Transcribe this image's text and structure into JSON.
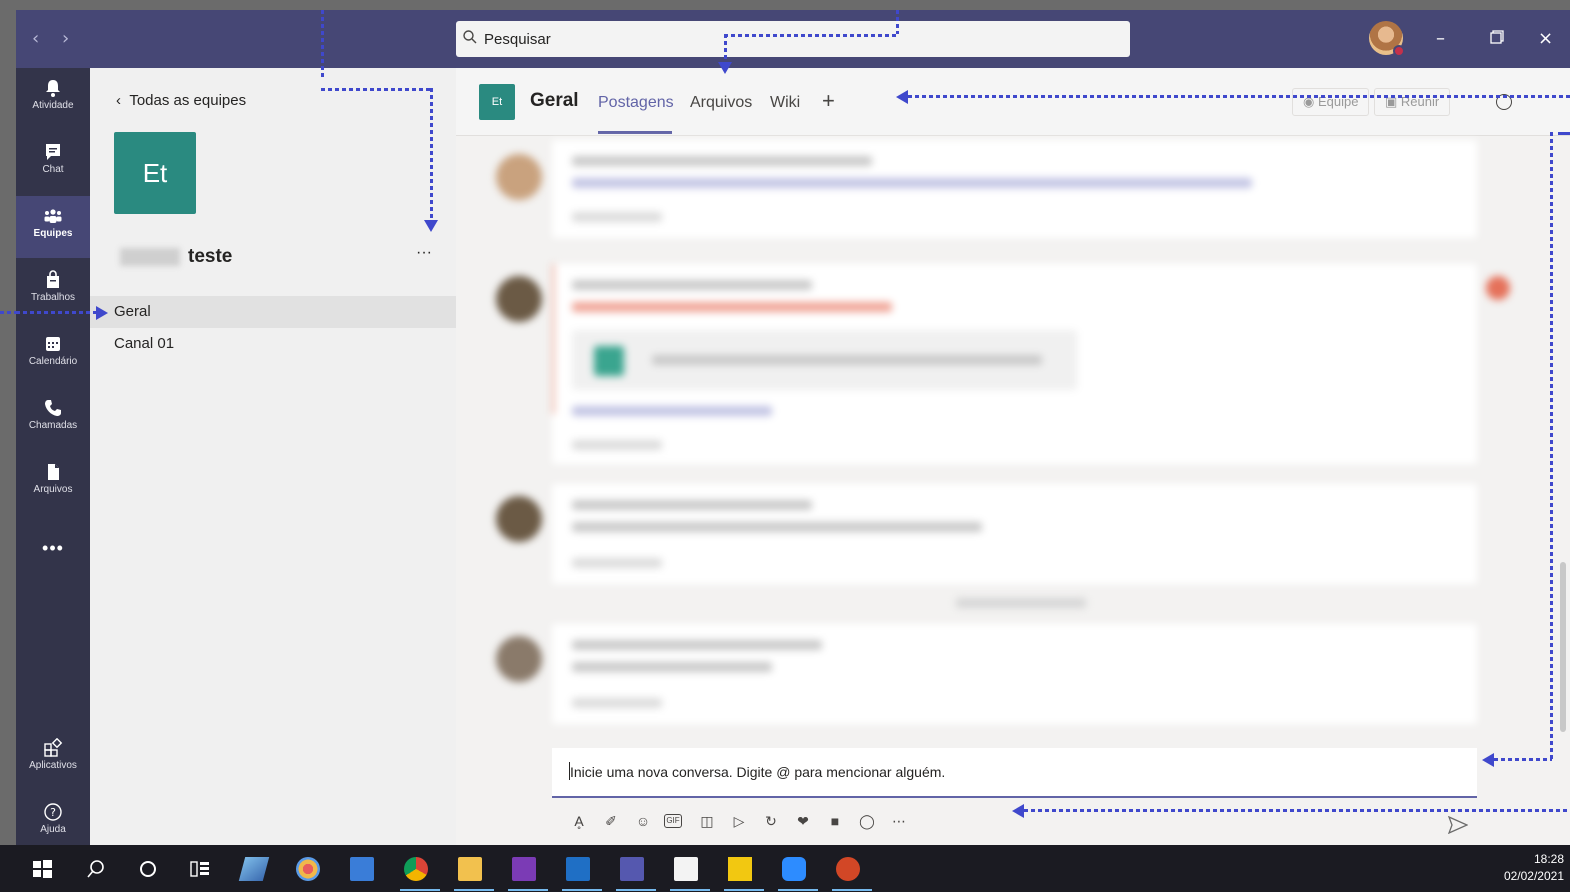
{
  "titlebar": {
    "search_placeholder": "Pesquisar",
    "back_icon": "chevron-left-icon",
    "forward_icon": "chevron-right-icon",
    "window_controls": [
      "minimize",
      "restore",
      "close"
    ]
  },
  "rail": {
    "items": [
      {
        "label": "Atividade",
        "icon": "bell-icon"
      },
      {
        "label": "Chat",
        "icon": "chat-icon"
      },
      {
        "label": "Equipes",
        "icon": "teams-icon",
        "active": true
      },
      {
        "label": "Trabalhos",
        "icon": "assignments-icon"
      },
      {
        "label": "Calendário",
        "icon": "calendar-icon"
      },
      {
        "label": "Chamadas",
        "icon": "phone-icon"
      },
      {
        "label": "Arquivos",
        "icon": "file-icon"
      }
    ],
    "more": "•••",
    "bottom": [
      {
        "label": "Aplicativos",
        "icon": "apps-icon"
      },
      {
        "label": "Ajuda",
        "icon": "help-icon"
      }
    ]
  },
  "team_panel": {
    "back_label": "Todas as equipes",
    "team_initials": "Et",
    "team_name": "teste",
    "more": "···",
    "channels": [
      {
        "label": "Geral",
        "selected": true
      },
      {
        "label": "Canal 01",
        "selected": false
      }
    ]
  },
  "channel_header": {
    "tile_initials": "Et",
    "channel_name": "Geral",
    "tabs": [
      {
        "label": "Postagens",
        "active": true
      },
      {
        "label": "Arquivos",
        "active": false
      },
      {
        "label": "Wiki",
        "active": false
      }
    ],
    "add_tab": "+",
    "team_button": "Equipe",
    "meet_button": "Reunir"
  },
  "composer": {
    "placeholder": "Inicie uma nova conversa. Digite @ para mencionar alguém.",
    "tools": [
      "format-icon",
      "attach-icon",
      "emoji-icon",
      "gif-icon",
      "sticker-icon",
      "meet-icon",
      "loop-icon",
      "praise-icon",
      "video-icon",
      "bulb-icon",
      "more-icon"
    ],
    "gif_label": "GIF"
  },
  "taskbar": {
    "time": "18:28",
    "date": "02/02/2021"
  },
  "colors": {
    "titlebar": "#464775",
    "rail": "#33344a",
    "accent": "#6264a7",
    "team_tile": "#2a8a80",
    "annotation": "#3f48cc"
  }
}
